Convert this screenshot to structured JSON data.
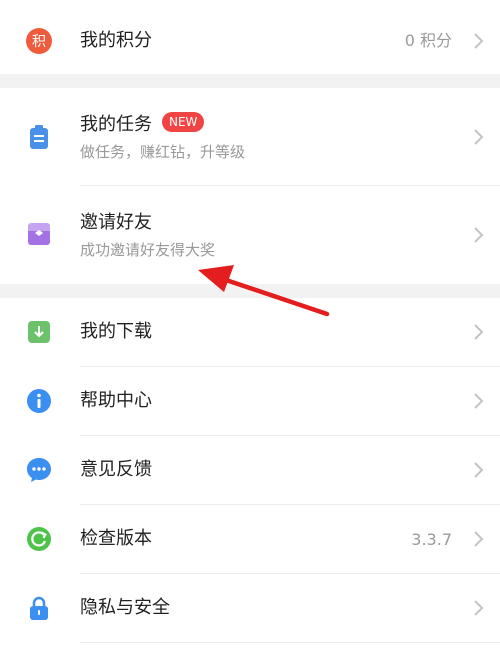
{
  "points": {
    "title": "我的积分",
    "value": "0 积分",
    "badge_char": "积"
  },
  "tasks": {
    "title": "我的任务",
    "badge": "NEW",
    "subtitle": "做任务，赚红钻，升等级"
  },
  "invite": {
    "title": "邀请好友",
    "subtitle": "成功邀请好友得大奖"
  },
  "menu": [
    {
      "title": "我的下载",
      "value": ""
    },
    {
      "title": "帮助中心",
      "value": ""
    },
    {
      "title": "意见反馈",
      "value": ""
    },
    {
      "title": "检查版本",
      "value": "3.3.7"
    },
    {
      "title": "隐私与安全",
      "value": ""
    }
  ],
  "colors": {
    "points_icon": "#ef5c3d",
    "tasks_icon": "#4a8fe8",
    "invite_icon": "#a572e6",
    "download_icon": "#6cc26a",
    "help_icon": "#3b8ff0",
    "feedback_icon": "#3b8ff0",
    "version_icon": "#4fc24a",
    "privacy_icon": "#3b8ff0",
    "annotation_arrow": "#e41e1e"
  }
}
